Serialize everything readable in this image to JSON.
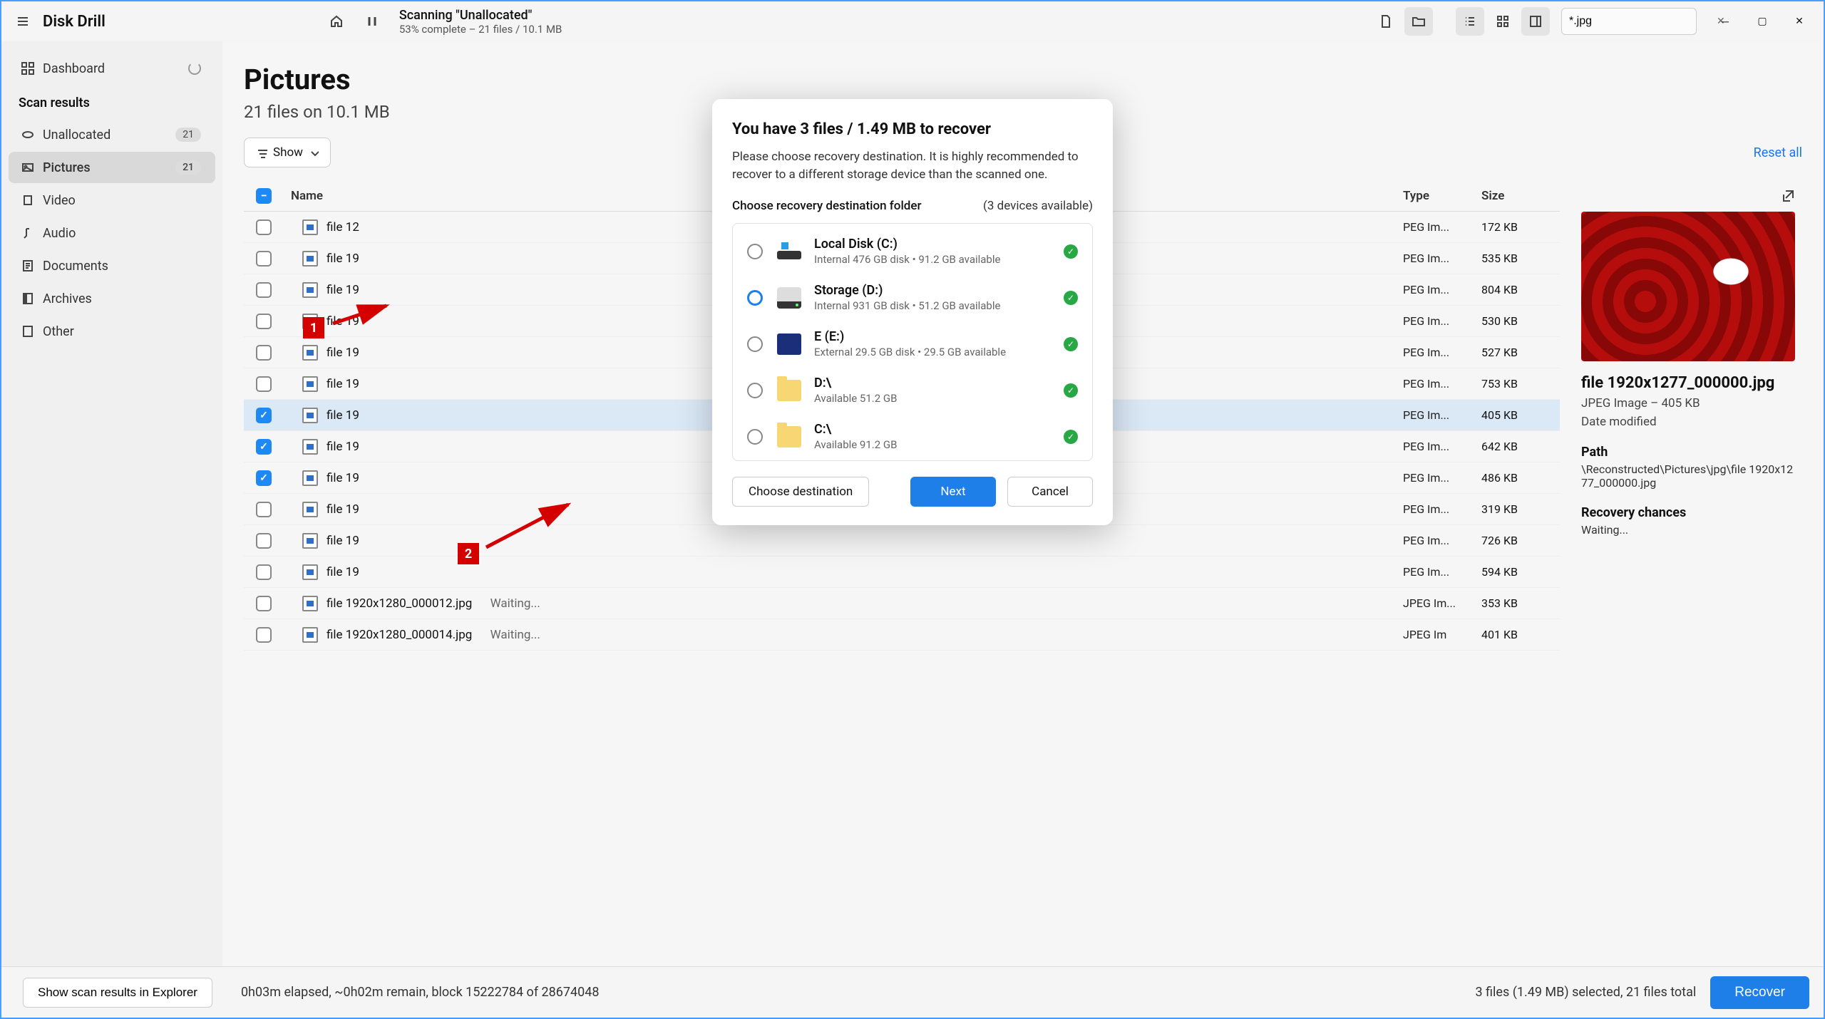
{
  "app": {
    "title": "Disk Drill"
  },
  "scan": {
    "title": "Scanning \"Unallocated\"",
    "subtitle": "53% complete – 21 files / 10.1 MB"
  },
  "search": {
    "value": "*.jpg"
  },
  "sidebar": {
    "dashboard": "Dashboard",
    "section": "Scan results",
    "items": [
      {
        "label": "Unallocated",
        "badge": "21"
      },
      {
        "label": "Pictures",
        "badge": "21"
      },
      {
        "label": "Video"
      },
      {
        "label": "Audio"
      },
      {
        "label": "Documents"
      },
      {
        "label": "Archives"
      },
      {
        "label": "Other"
      }
    ]
  },
  "page": {
    "title": "Pictures",
    "subtitle": "21 files on 10.1 MB",
    "show": "Show",
    "reset": "Reset all"
  },
  "table": {
    "cols": {
      "name": "Name",
      "type": "Type",
      "size": "Size"
    },
    "rows": [
      {
        "name": "file 12",
        "type": "PEG Im...",
        "size": "172 KB",
        "checked": false
      },
      {
        "name": "file 19",
        "type": "PEG Im...",
        "size": "535 KB",
        "checked": false
      },
      {
        "name": "file 19",
        "type": "PEG Im...",
        "size": "804 KB",
        "checked": false
      },
      {
        "name": "file 19",
        "type": "PEG Im...",
        "size": "530 KB",
        "checked": false
      },
      {
        "name": "file 19",
        "type": "PEG Im...",
        "size": "527 KB",
        "checked": false
      },
      {
        "name": "file 19",
        "type": "PEG Im...",
        "size": "753 KB",
        "checked": false
      },
      {
        "name": "file 19",
        "type": "PEG Im...",
        "size": "405 KB",
        "checked": true,
        "sel": true
      },
      {
        "name": "file 19",
        "type": "PEG Im...",
        "size": "642 KB",
        "checked": true
      },
      {
        "name": "file 19",
        "type": "PEG Im...",
        "size": "486 KB",
        "checked": true
      },
      {
        "name": "file 19",
        "type": "PEG Im...",
        "size": "319 KB",
        "checked": false
      },
      {
        "name": "file 19",
        "type": "PEG Im...",
        "size": "726 KB",
        "checked": false
      },
      {
        "name": "file 19",
        "type": "PEG Im...",
        "size": "594 KB",
        "checked": false
      },
      {
        "name": "file 1920x1280_000012.jpg",
        "status": "Waiting...",
        "type": "JPEG Im...",
        "size": "353 KB",
        "checked": false
      },
      {
        "name": "file 1920x1280_000014.jpg",
        "status": "Waiting...",
        "type": "JPEG Im",
        "size": "401 KB",
        "checked": false
      }
    ]
  },
  "preview": {
    "title": "file 1920x1277_000000.jpg",
    "meta": "JPEG Image – 405 KB",
    "date_label": "Date modified",
    "path_label": "Path",
    "path": "\\Reconstructed\\Pictures\\jpg\\file 1920x1277_000000.jpg",
    "chances_label": "Recovery chances",
    "chances": "Waiting..."
  },
  "bottom": {
    "explorer": "Show scan results in Explorer",
    "status": "0h03m elapsed, ~0h02m remain, block 15222784 of 28674048",
    "selected": "3 files (1.49 MB) selected, 21 files total",
    "recover": "Recover"
  },
  "modal": {
    "title": "You have 3 files / 1.49 MB to recover",
    "desc": "Please choose recovery destination. It is highly recommended to recover to a different storage device than the scanned one.",
    "choose_label": "Choose recovery destination folder",
    "devices_label": "(3 devices available)",
    "dests": [
      {
        "name": "Local Disk (C:)",
        "info": "Internal 476 GB disk • 91.2 GB available",
        "icon": "win"
      },
      {
        "name": "Storage (D:)",
        "info": "Internal 931 GB disk • 51.2 GB available",
        "icon": "disk",
        "selected": true
      },
      {
        "name": "E (E:)",
        "info": "External 29.5 GB disk • 29.5 GB available",
        "icon": "sd"
      },
      {
        "name": "D:\\",
        "info": "Available 51.2 GB",
        "icon": "folder"
      },
      {
        "name": "C:\\",
        "info": "Available 91.2 GB",
        "icon": "folder"
      }
    ],
    "choose_btn": "Choose destination",
    "next": "Next",
    "cancel": "Cancel"
  },
  "anno": {
    "one": "1",
    "two": "2"
  }
}
